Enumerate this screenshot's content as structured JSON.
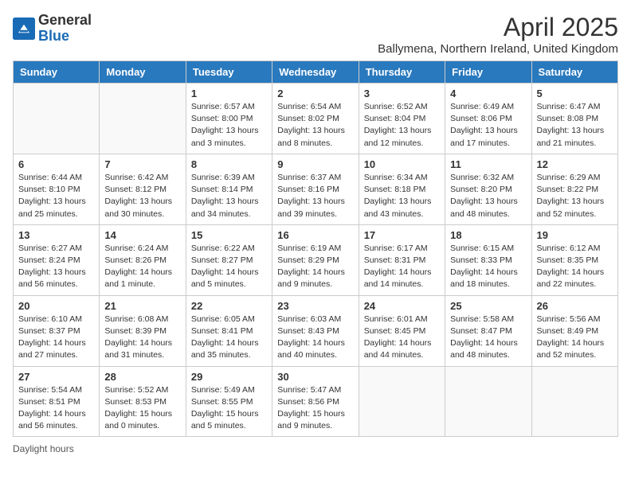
{
  "header": {
    "logo_general": "General",
    "logo_blue": "Blue",
    "month_title": "April 2025",
    "subtitle": "Ballymena, Northern Ireland, United Kingdom"
  },
  "days_of_week": [
    "Sunday",
    "Monday",
    "Tuesday",
    "Wednesday",
    "Thursday",
    "Friday",
    "Saturday"
  ],
  "weeks": [
    [
      {
        "day": "",
        "info": ""
      },
      {
        "day": "",
        "info": ""
      },
      {
        "day": "1",
        "info": "Sunrise: 6:57 AM\nSunset: 8:00 PM\nDaylight: 13 hours and 3 minutes."
      },
      {
        "day": "2",
        "info": "Sunrise: 6:54 AM\nSunset: 8:02 PM\nDaylight: 13 hours and 8 minutes."
      },
      {
        "day": "3",
        "info": "Sunrise: 6:52 AM\nSunset: 8:04 PM\nDaylight: 13 hours and 12 minutes."
      },
      {
        "day": "4",
        "info": "Sunrise: 6:49 AM\nSunset: 8:06 PM\nDaylight: 13 hours and 17 minutes."
      },
      {
        "day": "5",
        "info": "Sunrise: 6:47 AM\nSunset: 8:08 PM\nDaylight: 13 hours and 21 minutes."
      }
    ],
    [
      {
        "day": "6",
        "info": "Sunrise: 6:44 AM\nSunset: 8:10 PM\nDaylight: 13 hours and 25 minutes."
      },
      {
        "day": "7",
        "info": "Sunrise: 6:42 AM\nSunset: 8:12 PM\nDaylight: 13 hours and 30 minutes."
      },
      {
        "day": "8",
        "info": "Sunrise: 6:39 AM\nSunset: 8:14 PM\nDaylight: 13 hours and 34 minutes."
      },
      {
        "day": "9",
        "info": "Sunrise: 6:37 AM\nSunset: 8:16 PM\nDaylight: 13 hours and 39 minutes."
      },
      {
        "day": "10",
        "info": "Sunrise: 6:34 AM\nSunset: 8:18 PM\nDaylight: 13 hours and 43 minutes."
      },
      {
        "day": "11",
        "info": "Sunrise: 6:32 AM\nSunset: 8:20 PM\nDaylight: 13 hours and 48 minutes."
      },
      {
        "day": "12",
        "info": "Sunrise: 6:29 AM\nSunset: 8:22 PM\nDaylight: 13 hours and 52 minutes."
      }
    ],
    [
      {
        "day": "13",
        "info": "Sunrise: 6:27 AM\nSunset: 8:24 PM\nDaylight: 13 hours and 56 minutes."
      },
      {
        "day": "14",
        "info": "Sunrise: 6:24 AM\nSunset: 8:26 PM\nDaylight: 14 hours and 1 minute."
      },
      {
        "day": "15",
        "info": "Sunrise: 6:22 AM\nSunset: 8:27 PM\nDaylight: 14 hours and 5 minutes."
      },
      {
        "day": "16",
        "info": "Sunrise: 6:19 AM\nSunset: 8:29 PM\nDaylight: 14 hours and 9 minutes."
      },
      {
        "day": "17",
        "info": "Sunrise: 6:17 AM\nSunset: 8:31 PM\nDaylight: 14 hours and 14 minutes."
      },
      {
        "day": "18",
        "info": "Sunrise: 6:15 AM\nSunset: 8:33 PM\nDaylight: 14 hours and 18 minutes."
      },
      {
        "day": "19",
        "info": "Sunrise: 6:12 AM\nSunset: 8:35 PM\nDaylight: 14 hours and 22 minutes."
      }
    ],
    [
      {
        "day": "20",
        "info": "Sunrise: 6:10 AM\nSunset: 8:37 PM\nDaylight: 14 hours and 27 minutes."
      },
      {
        "day": "21",
        "info": "Sunrise: 6:08 AM\nSunset: 8:39 PM\nDaylight: 14 hours and 31 minutes."
      },
      {
        "day": "22",
        "info": "Sunrise: 6:05 AM\nSunset: 8:41 PM\nDaylight: 14 hours and 35 minutes."
      },
      {
        "day": "23",
        "info": "Sunrise: 6:03 AM\nSunset: 8:43 PM\nDaylight: 14 hours and 40 minutes."
      },
      {
        "day": "24",
        "info": "Sunrise: 6:01 AM\nSunset: 8:45 PM\nDaylight: 14 hours and 44 minutes."
      },
      {
        "day": "25",
        "info": "Sunrise: 5:58 AM\nSunset: 8:47 PM\nDaylight: 14 hours and 48 minutes."
      },
      {
        "day": "26",
        "info": "Sunrise: 5:56 AM\nSunset: 8:49 PM\nDaylight: 14 hours and 52 minutes."
      }
    ],
    [
      {
        "day": "27",
        "info": "Sunrise: 5:54 AM\nSunset: 8:51 PM\nDaylight: 14 hours and 56 minutes."
      },
      {
        "day": "28",
        "info": "Sunrise: 5:52 AM\nSunset: 8:53 PM\nDaylight: 15 hours and 0 minutes."
      },
      {
        "day": "29",
        "info": "Sunrise: 5:49 AM\nSunset: 8:55 PM\nDaylight: 15 hours and 5 minutes."
      },
      {
        "day": "30",
        "info": "Sunrise: 5:47 AM\nSunset: 8:56 PM\nDaylight: 15 hours and 9 minutes."
      },
      {
        "day": "",
        "info": ""
      },
      {
        "day": "",
        "info": ""
      },
      {
        "day": "",
        "info": ""
      }
    ]
  ],
  "footer": {
    "note": "Daylight hours"
  }
}
